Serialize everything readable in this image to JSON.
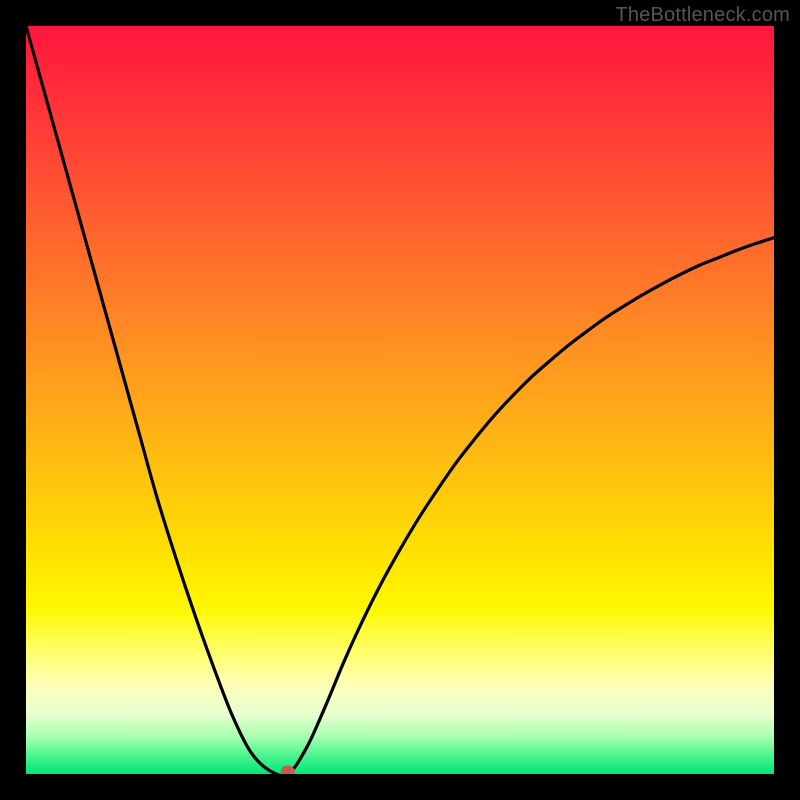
{
  "watermark": "TheBottleneck.com",
  "colors": {
    "curve": "#000000",
    "marker": "#c65b4e",
    "background": "#000000"
  },
  "chart_data": {
    "type": "line",
    "title": "",
    "xlabel": "",
    "ylabel": "",
    "xlim": [
      0,
      100
    ],
    "ylim": [
      0,
      100
    ],
    "series": [
      {
        "name": "bottleneck-curve",
        "x": [
          0,
          2.5,
          5,
          7.5,
          10,
          12.5,
          15,
          17.5,
          20,
          22.5,
          25,
          27.5,
          30,
          32.5,
          35,
          37.5,
          40,
          42.5,
          45,
          47.5,
          50,
          52.5,
          55,
          57.5,
          60,
          62.5,
          65,
          67.5,
          70,
          72.5,
          75,
          77.5,
          80,
          82.5,
          85,
          87.5,
          90,
          92.5,
          95,
          97.5,
          100
        ],
        "y": [
          100,
          91.0,
          82.0,
          73.0,
          64.0,
          55.0,
          46.0,
          37.0,
          29.0,
          21.5,
          14.5,
          8.0,
          3.0,
          0.5,
          0.0,
          3.5,
          9.0,
          15.0,
          20.5,
          25.5,
          30.0,
          34.2,
          38.0,
          41.6,
          44.8,
          47.8,
          50.5,
          53.0,
          55.2,
          57.3,
          59.2,
          61.0,
          62.6,
          64.1,
          65.5,
          66.8,
          68.0,
          69.0,
          70.0,
          70.9,
          71.7
        ]
      }
    ],
    "marker": {
      "x": 35,
      "y": 0
    },
    "grid": false,
    "legend": false
  }
}
